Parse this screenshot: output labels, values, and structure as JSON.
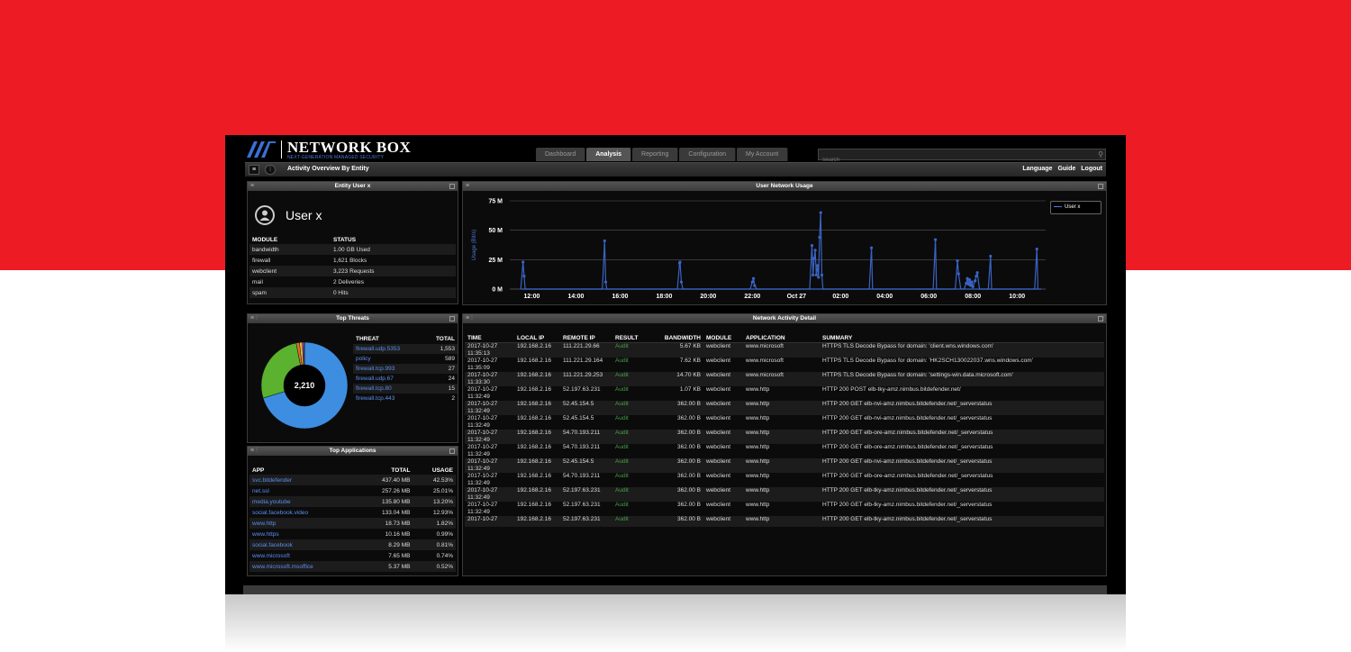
{
  "app": {
    "brand": "NETWORK BOX",
    "tagline": "NEXT-GENERATION MANAGED SECURITY",
    "tabs": [
      "Dashboard",
      "Analysis",
      "Reporting",
      "Configuration",
      "My Account"
    ],
    "active_tab": "Analysis",
    "search_placeholder": "Search",
    "page_title": "Activity Overview By Entity",
    "menu_right": [
      "Language",
      "Guide",
      "Logout"
    ]
  },
  "entity": {
    "title": "Entity User x",
    "user": "User x",
    "headers": [
      "MODULE",
      "STATUS"
    ],
    "rows": [
      [
        "bandwidth",
        "1.00 GB Used"
      ],
      [
        "firewall",
        "1,621 Blocks"
      ],
      [
        "webclient",
        "3,223 Requests"
      ],
      [
        "mail",
        "2 Deliveries"
      ],
      [
        "spam",
        "0 Hits"
      ]
    ]
  },
  "usage_chart": {
    "title": "User Network Usage",
    "legend": "User x",
    "chart_data": {
      "type": "line",
      "ylabel": "Usage (Bit/s)",
      "ylim": [
        0,
        75
      ],
      "y_ticks": [
        "0 M",
        "25 M",
        "50 M",
        "75 M"
      ],
      "x_ticks": [
        "12:00",
        "14:00",
        "16:00",
        "18:00",
        "20:00",
        "22:00",
        "Oct 27",
        "02:00",
        "04:00",
        "06:00",
        "08:00",
        "10:00"
      ],
      "series": [
        {
          "name": "User x",
          "color": "#3a63c4",
          "points": [
            [
              11.5,
              0
            ],
            [
              11.6,
              23
            ],
            [
              11.65,
              11
            ],
            [
              11.7,
              0
            ],
            [
              15.2,
              0
            ],
            [
              15.3,
              41
            ],
            [
              15.35,
              6
            ],
            [
              15.4,
              0
            ],
            [
              18.6,
              0
            ],
            [
              18.7,
              22
            ],
            [
              18.72,
              23
            ],
            [
              18.78,
              6
            ],
            [
              18.85,
              0
            ],
            [
              21.9,
              0
            ],
            [
              22.0,
              6
            ],
            [
              22.05,
              9
            ],
            [
              22.1,
              3
            ],
            [
              22.2,
              0
            ],
            [
              24.6,
              0
            ],
            [
              24.7,
              37
            ],
            [
              24.75,
              12
            ],
            [
              24.8,
              26
            ],
            [
              24.85,
              33
            ],
            [
              24.9,
              12
            ],
            [
              24.95,
              20
            ],
            [
              25.0,
              10
            ],
            [
              25.05,
              44
            ],
            [
              25.1,
              65
            ],
            [
              25.15,
              12
            ],
            [
              25.2,
              0
            ],
            [
              27.3,
              0
            ],
            [
              27.4,
              35
            ],
            [
              27.45,
              0
            ],
            [
              30.2,
              0
            ],
            [
              30.3,
              42
            ],
            [
              30.35,
              0
            ],
            [
              31.2,
              0
            ],
            [
              31.3,
              24
            ],
            [
              31.35,
              13
            ],
            [
              31.45,
              0
            ],
            [
              31.6,
              0
            ],
            [
              31.7,
              5
            ],
            [
              31.75,
              9
            ],
            [
              31.8,
              4
            ],
            [
              31.85,
              8
            ],
            [
              31.9,
              3
            ],
            [
              31.95,
              6
            ],
            [
              32.0,
              2
            ],
            [
              32.1,
              7
            ],
            [
              32.15,
              11
            ],
            [
              32.2,
              14
            ],
            [
              32.3,
              0
            ],
            [
              32.7,
              0
            ],
            [
              32.8,
              28
            ],
            [
              32.85,
              0
            ],
            [
              34.8,
              0
            ],
            [
              34.9,
              34
            ],
            [
              34.95,
              0
            ]
          ]
        }
      ]
    }
  },
  "threats": {
    "title": "Top Threats",
    "total": "2,210",
    "headers": [
      "THREAT",
      "TOTAL"
    ],
    "rows": [
      [
        "firewall.udp.5353",
        "1,553"
      ],
      [
        "policy",
        "589"
      ],
      [
        "firewall.tcp.993",
        "27"
      ],
      [
        "firewall.udp.67",
        "24"
      ],
      [
        "firewall.tcp.80",
        "15"
      ],
      [
        "firewall.tcp.443",
        "2"
      ]
    ],
    "chart_data": {
      "type": "pie",
      "categories": [
        "firewall.udp.5353",
        "policy",
        "firewall.tcp.993",
        "firewall.udp.67",
        "firewall.tcp.80",
        "firewall.tcp.443"
      ],
      "values": [
        1553,
        589,
        27,
        24,
        15,
        2
      ],
      "colors": [
        "#3d8ee0",
        "#5ab22e",
        "#e07030",
        "#e0c030",
        "#a040c0",
        "#d04060"
      ]
    }
  },
  "apps": {
    "title": "Top Applications",
    "headers": [
      "APP",
      "TOTAL",
      "USAGE"
    ],
    "rows": [
      [
        "svc.bitdefender",
        "437.40 MB",
        "42.53%"
      ],
      [
        "net.ssl",
        "257.26 MB",
        "25.01%"
      ],
      [
        "media.youtube",
        "135.80 MB",
        "13.20%"
      ],
      [
        "social.facebook.video",
        "133.04 MB",
        "12.93%"
      ],
      [
        "www.http",
        "18.73 MB",
        "1.82%"
      ],
      [
        "www.https",
        "10.16 MB",
        "0.99%"
      ],
      [
        "social.facebook",
        "8.29 MB",
        "0.81%"
      ],
      [
        "www.microsoft",
        "7.65 MB",
        "0.74%"
      ],
      [
        "www.microsoft.msoffice",
        "5.37 MB",
        "0.52%"
      ]
    ]
  },
  "activity": {
    "title": "Network Activity Detail",
    "headers": [
      "TIME",
      "LOCAL IP",
      "REMOTE IP",
      "RESULT",
      "BANDWIDTH",
      "MODULE",
      "APPLICATION",
      "SUMMARY"
    ],
    "rows": [
      [
        "2017-10-27 11:35:13",
        "192.168.2.16",
        "111.221.29.66",
        "Audit",
        "5.67 KB",
        "webclient",
        "www.microsoft",
        "HTTPS TLS Decode Bypass for domain: 'client.wns.windows.com'"
      ],
      [
        "2017-10-27 11:35:09",
        "192.168.2.16",
        "111.221.29.164",
        "Audit",
        "7.62 KB",
        "webclient",
        "www.microsoft",
        "HTTPS TLS Decode Bypass for domain: 'HK2SCH130022037.wns.windows.com'"
      ],
      [
        "2017-10-27 11:33:30",
        "192.168.2.16",
        "111.221.29.253",
        "Audit",
        "14.70 KB",
        "webclient",
        "www.microsoft",
        "HTTPS TLS Decode Bypass for domain: 'settings-win.data.microsoft.com'"
      ],
      [
        "2017-10-27 11:32:49",
        "192.168.2.16",
        "52.197.63.231",
        "Audit",
        "1.07 KB",
        "webclient",
        "www.http",
        "HTTP 200 POST elb-tky-amz.nimbus.bitdefender.net/"
      ],
      [
        "2017-10-27 11:32:49",
        "192.168.2.16",
        "52.45.154.5",
        "Audit",
        "362.00 B",
        "webclient",
        "www.http",
        "HTTP 200 GET elb-nvi-amz.nimbus.bitdefender.net/_serverstatus"
      ],
      [
        "2017-10-27 11:32:49",
        "192.168.2.16",
        "52.45.154.5",
        "Audit",
        "362.00 B",
        "webclient",
        "www.http",
        "HTTP 200 GET elb-nvi-amz.nimbus.bitdefender.net/_serverstatus"
      ],
      [
        "2017-10-27 11:32:49",
        "192.168.2.16",
        "54.70.193.211",
        "Audit",
        "362.00 B",
        "webclient",
        "www.http",
        "HTTP 200 GET elb-ore-amz.nimbus.bitdefender.net/_serverstatus"
      ],
      [
        "2017-10-27 11:32:49",
        "192.168.2.16",
        "54.70.193.211",
        "Audit",
        "362.00 B",
        "webclient",
        "www.http",
        "HTTP 200 GET elb-ore-amz.nimbus.bitdefender.net/_serverstatus"
      ],
      [
        "2017-10-27 11:32:49",
        "192.168.2.16",
        "52.45.154.5",
        "Audit",
        "362.00 B",
        "webclient",
        "www.http",
        "HTTP 200 GET elb-nvi-amz.nimbus.bitdefender.net/_serverstatus"
      ],
      [
        "2017-10-27 11:32:49",
        "192.168.2.16",
        "54.70.193.211",
        "Audit",
        "362.00 B",
        "webclient",
        "www.http",
        "HTTP 200 GET elb-ore-amz.nimbus.bitdefender.net/_serverstatus"
      ],
      [
        "2017-10-27 11:32:49",
        "192.168.2.16",
        "52.197.63.231",
        "Audit",
        "362.00 B",
        "webclient",
        "www.http",
        "HTTP 200 GET elb-tky-amz.nimbus.bitdefender.net/_serverstatus"
      ],
      [
        "2017-10-27 11:32:49",
        "192.168.2.16",
        "52.197.63.231",
        "Audit",
        "362.00 B",
        "webclient",
        "www.http",
        "HTTP 200 GET elb-tky-amz.nimbus.bitdefender.net/_serverstatus"
      ],
      [
        "2017-10-27",
        "192.168.2.16",
        "52.197.63.231",
        "Audit",
        "362.00 B",
        "webclient",
        "www.http",
        "HTTP 200 GET elb-tky-amz.nimbus.bitdefender.net/_serverstatus"
      ]
    ]
  }
}
